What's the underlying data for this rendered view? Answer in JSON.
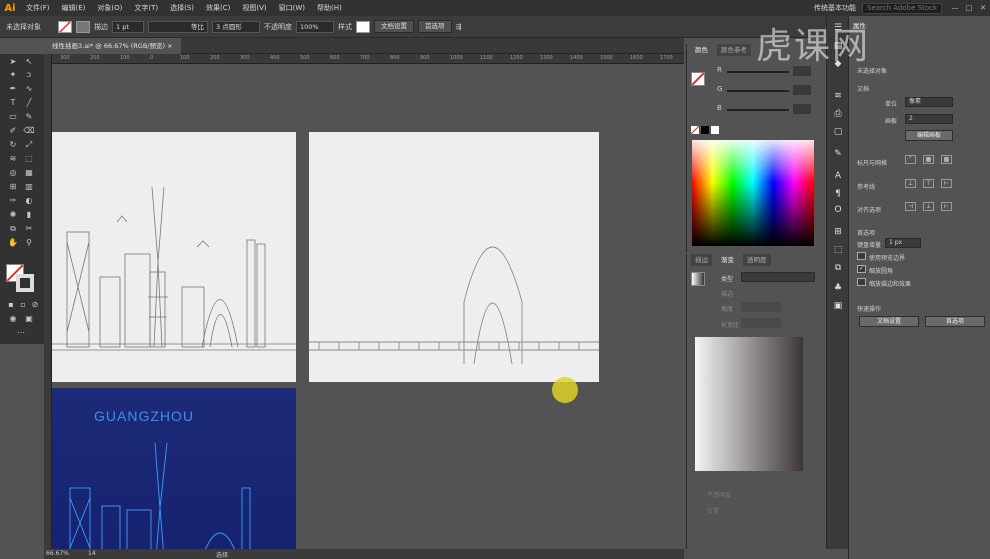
{
  "app": {
    "logo": "Ai",
    "workspace": "传统基本功能",
    "search_placeholder": "Search Adobe Stock"
  },
  "menu": [
    "文件(F)",
    "编辑(E)",
    "对象(O)",
    "文字(T)",
    "选择(S)",
    "效果(C)",
    "视图(V)",
    "窗口(W)",
    "帮助(H)"
  ],
  "window_controls": [
    "—",
    "□",
    "✕"
  ],
  "control_bar": {
    "selection": "未选择对象",
    "stroke_label": "描边",
    "stroke_value": "1 pt",
    "stroke_style": "等比",
    "brush_label": "3 点圆形",
    "opacity_label": "不透明度",
    "opacity_value": "100%",
    "style_label": "样式",
    "doc_setup": "文档设置",
    "preferences": "首选项"
  },
  "document": {
    "tab_title": "线性插画3.ai* @ 66.67% (RGB/预览)",
    "close": "×"
  },
  "ruler_ticks": [
    "300",
    "200",
    "100",
    "0",
    "100",
    "200",
    "300",
    "400",
    "500",
    "600",
    "700",
    "800",
    "900",
    "1000",
    "1100",
    "1200",
    "1300",
    "1400",
    "1500",
    "1600",
    "1700"
  ],
  "status": {
    "zoom": "66.67%",
    "page": "14",
    "tool": "选择"
  },
  "artwork": {
    "title": "GUANGZHOU"
  },
  "color_panel": {
    "tabs": [
      "颜色",
      "颜色参考"
    ],
    "channels": [
      {
        "label": "R"
      },
      {
        "label": "G"
      },
      {
        "label": "B"
      }
    ]
  },
  "gradient_panel": {
    "tabs": [
      "描边",
      "渐变",
      "透明度"
    ],
    "type_label": "类型",
    "fields": [
      "描边",
      "角度",
      "长宽比"
    ],
    "footer": [
      "不透明度",
      "位置"
    ]
  },
  "properties": {
    "tab": "属性",
    "sections": {
      "no_selection": "未选择对象",
      "document": "文档",
      "units_label": "单位",
      "units_value": "像素",
      "artboard_label": "画板",
      "artboard_value": "2",
      "edit_artboards": "编辑画板",
      "rulers_grids": "标尺与网格",
      "guides": "参考线",
      "snap": "对齐选项",
      "preferences": "首选项",
      "keyboard_increment": "键盘增量",
      "keyboard_value": "1 px",
      "use_preview_bounds": "使用预览边界",
      "scale_corners": "缩放圆角",
      "scale_strokes": "缩放描边和效果",
      "quick_actions": "快速操作",
      "doc_setup": "文档设置",
      "prefs_button": "首选项"
    },
    "checks": {
      "use_preview_bounds": false,
      "scale_corners": true,
      "scale_strokes": false
    }
  },
  "watermark": "虎课网",
  "colors": {
    "menubar": "#323232",
    "panel": "#535353",
    "accent": "#ff9a00",
    "blue_art": "#1a2a7a"
  }
}
